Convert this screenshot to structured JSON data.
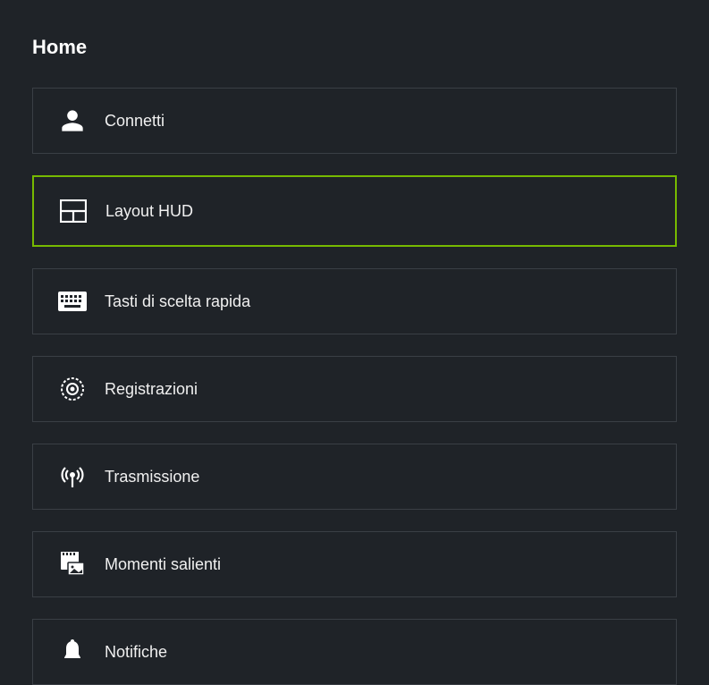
{
  "page": {
    "title": "Home"
  },
  "menu": {
    "items": [
      {
        "label": "Connetti",
        "icon": "person-icon",
        "selected": false
      },
      {
        "label": "Layout HUD",
        "icon": "layout-icon",
        "selected": true
      },
      {
        "label": "Tasti di scelta rapida",
        "icon": "keyboard-icon",
        "selected": false
      },
      {
        "label": "Registrazioni",
        "icon": "record-icon",
        "selected": false
      },
      {
        "label": "Trasmissione",
        "icon": "broadcast-icon",
        "selected": false
      },
      {
        "label": "Momenti salienti",
        "icon": "highlights-icon",
        "selected": false
      },
      {
        "label": "Notifiche",
        "icon": "bell-icon",
        "selected": false
      }
    ]
  },
  "colors": {
    "accent": "#76b900",
    "background": "#1f2328",
    "border": "#3a3f45"
  }
}
